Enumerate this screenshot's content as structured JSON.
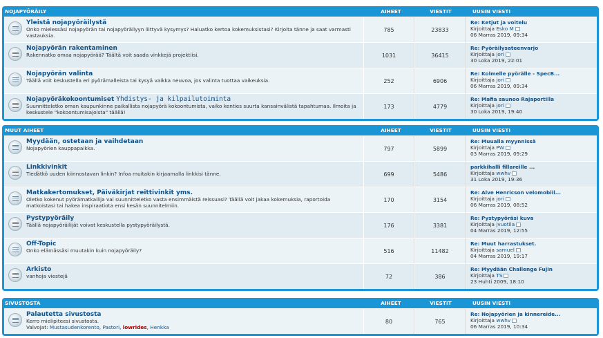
{
  "columns": {
    "topics": "AIHEET",
    "posts": "VIESTIT",
    "last": "UUSIN VIESTI"
  },
  "categories": [
    {
      "title": "NOJAPYÖRÄILY",
      "forums": [
        {
          "name": "Yleistä nojapyöräilystä",
          "subtitle": "",
          "desc": "Onko mielessäsi nojapyörän tai nojapyöräilyyn liittyvä kysymys? Haluatko kertoa kokemuksistasi? Kirjoita tänne ja saat varmasti vastauksia.",
          "topics": "785",
          "posts": "23833",
          "last_title": "Re: Ketjut ja voitelu",
          "last_by_prefix": "Kirjoittaja",
          "last_by": "Esko M",
          "last_date": "06 Marras 2019, 09:34"
        },
        {
          "name": "Nojapyörän rakentaminen",
          "subtitle": "",
          "desc": "Rakennatko omaa nojapyörää? Täältä voit saada vinkkejä projektiisi.",
          "topics": "1031",
          "posts": "36415",
          "last_title": "Re: Pyöräilysateenvarjo",
          "last_by_prefix": "Kirjoittaja",
          "last_by": "jori",
          "last_date": "30 Loka 2019, 22:01"
        },
        {
          "name": "Nojapyörän valinta",
          "subtitle": "",
          "desc": "Täällä voit keskustella eri pyörämalleista tai kysyä vaikka neuvoa, jos valinta tuottaa vaikeuksia.",
          "topics": "252",
          "posts": "6906",
          "last_title": "Re: Kolmelle pyörälle - SpecB...",
          "last_by_prefix": "Kirjoittaja",
          "last_by": "jori",
          "last_date": "06 Marras 2019, 09:34"
        },
        {
          "name": "Nojapyöräkokoontumiset",
          "subtitle": "Yhdistys- ja kilpailutoiminta",
          "desc": "Suunnitteletko oman kaupunkinne paikallista nojapyörä kokoontumista, vaiko kenties suurta kansainvälistä tapahtumaa. Ilmoita ja keskustele \"kokoontumisajoista\" täällä!",
          "topics": "173",
          "posts": "4779",
          "last_title": "Re: Mafia saunoo Rajaportilla",
          "last_by_prefix": "Kirjoittaja",
          "last_by": "jori",
          "last_date": "30 Loka 2019, 19:40"
        }
      ]
    },
    {
      "title": "MUUT AIHEET",
      "forums": [
        {
          "name": "Myydään, ostetaan ja vaihdetaan",
          "subtitle": "",
          "desc": "Nojapyörien kauppapaikka.",
          "topics": "797",
          "posts": "5899",
          "last_title": "Re: Muualla myynnissä",
          "last_by_prefix": "Kirjoittaja",
          "last_by": "PW",
          "last_date": "03 Marras 2019, 09:29"
        },
        {
          "name": "Linkkivinkit",
          "subtitle": "",
          "desc": "Tiedätkö uuden kiinnostavan linkin? Infoa muitakin kirjaamalla linkkisi tänne.",
          "topics": "699",
          "posts": "5486",
          "last_title": "parkkihalli fillareille ...",
          "last_by_prefix": "Kirjoittaja",
          "last_by": "wwhv",
          "last_date": "31 Loka 2019, 19:36"
        },
        {
          "name": "Matkakertomukset, Päiväkirjat reittivinkit yms.",
          "subtitle": "",
          "desc": "Oletko kokenut pyörämatkailija vai suunnitteletko vasta ensimmäistä reissuasi? Täällä voit jakaa kokemuksia, raportoida matkoistasi tai hakea inspiraatiota ensi kesän suunnitelmiin.",
          "topics": "170",
          "posts": "3154",
          "last_title": "Re: Alve Henricson velomobiil...",
          "last_by_prefix": "Kirjoittaja",
          "last_by": "jori",
          "last_date": "06 Marras 2019, 08:52"
        },
        {
          "name": "Pystypyöräily",
          "subtitle": "",
          "desc": "Täällä nojapyöräilijät voivat keskustella pystypyöräilystä.",
          "topics": "176",
          "posts": "3381",
          "last_title": "Re: Pystypyöräsi kuva",
          "last_by_prefix": "Kirjoittaja",
          "last_by": "jvuotila",
          "last_date": "04 Marras 2019, 12:55"
        },
        {
          "name": "Off-Topic",
          "subtitle": "",
          "desc": "Onko elämässäsi muutakin kuin nojapyöräily?",
          "topics": "516",
          "posts": "11482",
          "last_title": "Re: Muut harrastukset.",
          "last_by_prefix": "Kirjoittaja",
          "last_by": "samuel",
          "last_date": "04 Marras 2019, 19:17"
        },
        {
          "name": "Arkisto",
          "subtitle": "",
          "desc": "vanhoja viestejä",
          "topics": "72",
          "posts": "386",
          "last_title": "Re: Myydään Challenge Fujin",
          "last_by_prefix": "Kirjoittaja",
          "last_by": "TS",
          "last_date": "23 Huhti 2009, 18:10"
        }
      ]
    },
    {
      "title": "SIVUSTOSTA",
      "forums": [
        {
          "name": "Palautetta sivustosta",
          "subtitle": "",
          "desc": "Kerro mielipiteesi sivustosta.",
          "mods_label": "Valvojat:",
          "mods": [
            "Mustasudenkorento",
            "Pastori",
            "lowrides",
            "Henkka"
          ],
          "topics": "80",
          "posts": "765",
          "last_title": "Re: Nojapyörien ja kinnereide...",
          "last_by_prefix": "Kirjoittaja",
          "last_by": "wwhv",
          "last_date": "06 Marras 2019, 10:34"
        }
      ]
    }
  ]
}
